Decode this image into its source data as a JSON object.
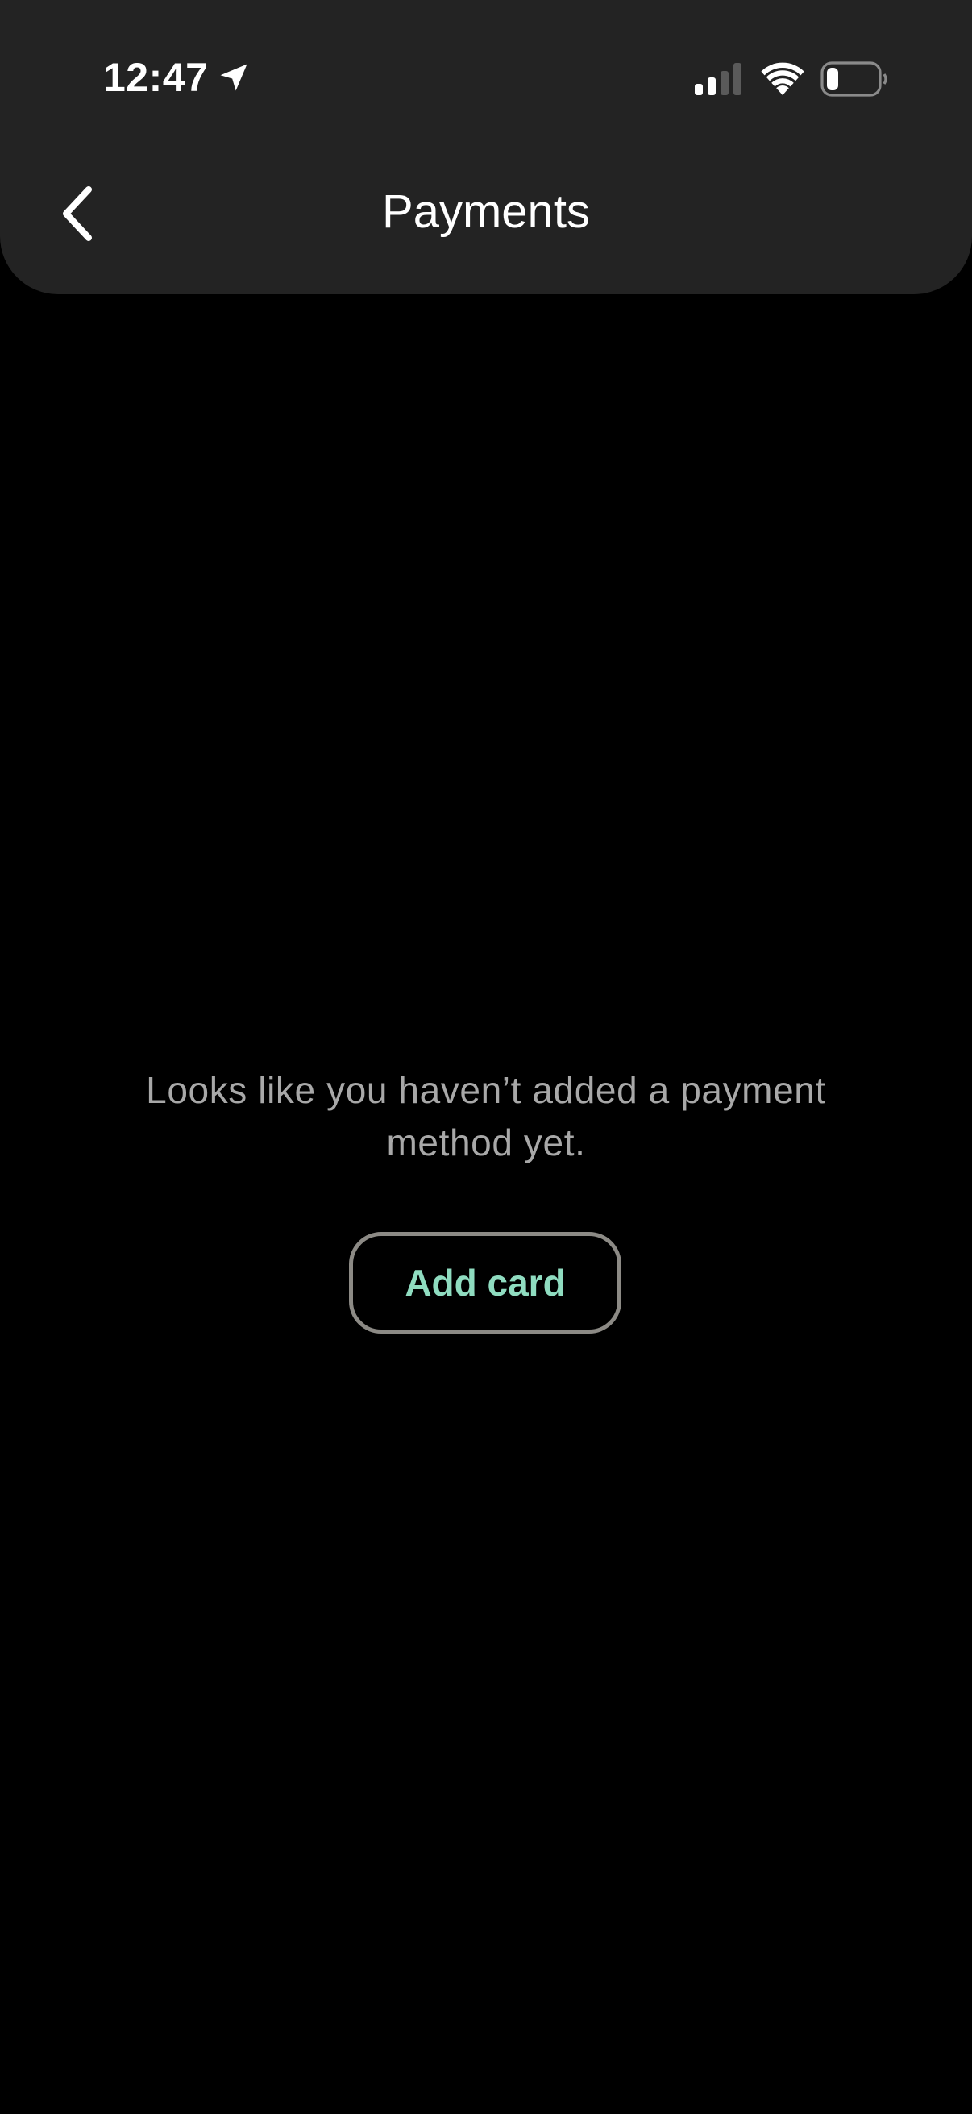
{
  "status_bar": {
    "time": "12:47",
    "icons": [
      "location-arrow-icon",
      "cellular-signal-icon",
      "wifi-icon",
      "battery-icon"
    ]
  },
  "nav": {
    "back_icon": "chevron-left-icon",
    "title": "Payments"
  },
  "empty_state": {
    "message": "Looks like you haven’t added a payment method yet.",
    "button_label": "Add card"
  },
  "colors": {
    "background": "#000000",
    "header_background": "#232323",
    "message_text": "#a8a8a8",
    "button_border": "#8c8a85",
    "button_text": "#8fdcc0"
  }
}
